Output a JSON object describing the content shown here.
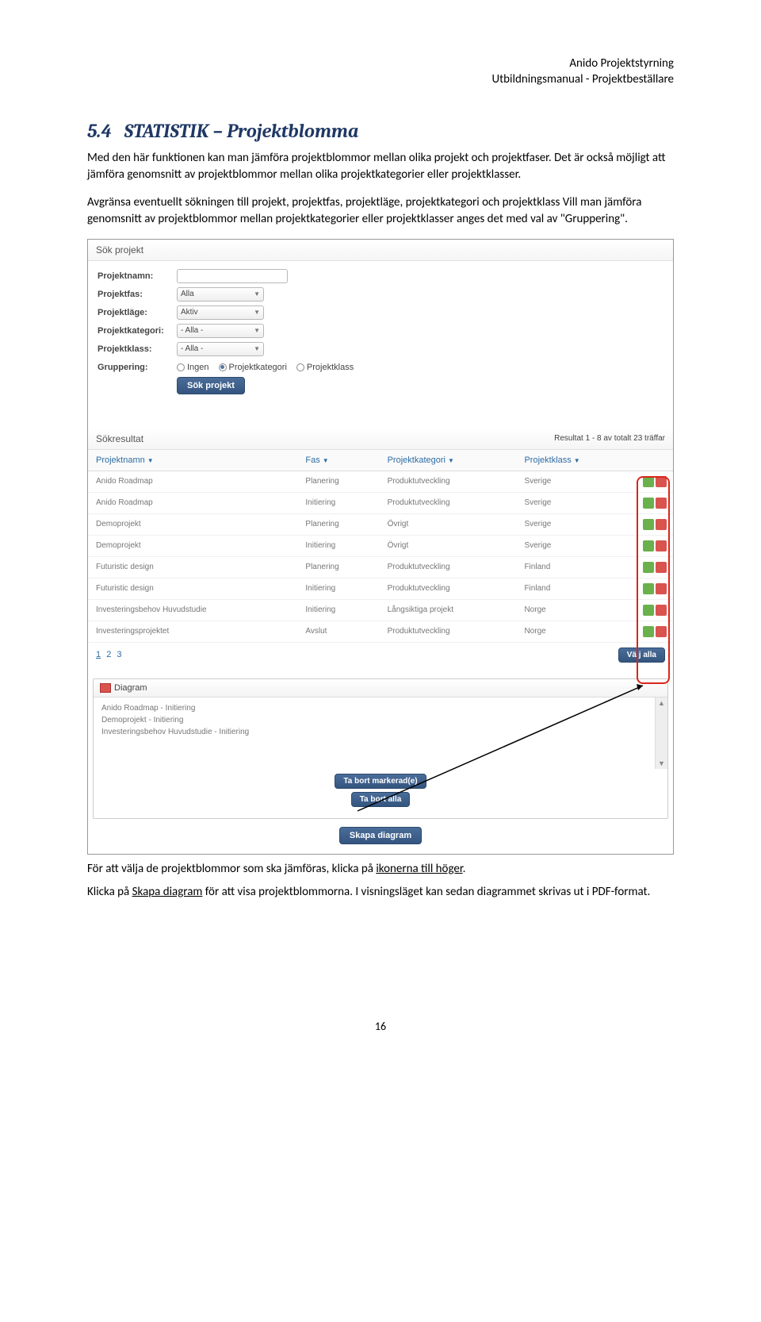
{
  "doc": {
    "header_l1": "Anido Projektstyrning",
    "header_l2": "Utbildningsmanual - Projektbeställare",
    "section_number": "5.4",
    "section_title": "STATISTIK – Projektblomma",
    "para1": "Med den här funktionen kan man jämföra projektblommor mellan olika projekt och projektfaser. Det är också möjligt att jämföra genomsnitt av projektblommor mellan olika projektkategorier eller projektklasser.",
    "para2": "Avgränsa eventuellt sökningen till projekt, projektfas, projektläge, projektkategori och projektklass Vill man jämföra genomsnitt av projektblommor mellan projektkategorier eller projektklasser anges det med val av \"Gruppering\".",
    "foot1_a": "För att välja de projektblommor som ska jämföras, klicka på ",
    "foot1_u": "ikonerna till höger",
    "foot1_b": ".",
    "foot2_a": "Klicka på ",
    "foot2_u": "Skapa diagram",
    "foot2_b": " för att visa projektblommorna. I visningsläget kan sedan diagrammet skrivas ut i PDF-format.",
    "page_num": "16"
  },
  "search": {
    "title": "Sök projekt",
    "labels": {
      "projektnamn": "Projektnamn:",
      "projektfas": "Projektfas:",
      "projektlage": "Projektläge:",
      "projektkategori": "Projektkategori:",
      "projektklass": "Projektklass:",
      "gruppering": "Gruppering:"
    },
    "values": {
      "projektfas": "Alla",
      "projektlage": "Aktiv",
      "projektkategori": "- Alla -",
      "projektklass": "- Alla -"
    },
    "radios": {
      "ingen": "Ingen",
      "projektkategori": "Projektkategori",
      "projektklass": "Projektklass"
    },
    "button": "Sök projekt"
  },
  "results": {
    "title": "Sökresultat",
    "count_text": "Resultat 1 - 8 av totalt 23 träffar",
    "columns": {
      "namn": "Projektnamn",
      "fas": "Fas",
      "kategori": "Projektkategori",
      "klass": "Projektklass"
    },
    "rows": [
      {
        "namn": "Anido Roadmap",
        "fas": "Planering",
        "kategori": "Produktutveckling",
        "klass": "Sverige"
      },
      {
        "namn": "Anido Roadmap",
        "fas": "Initiering",
        "kategori": "Produktutveckling",
        "klass": "Sverige"
      },
      {
        "namn": "Demoprojekt",
        "fas": "Planering",
        "kategori": "Övrigt",
        "klass": "Sverige"
      },
      {
        "namn": "Demoprojekt",
        "fas": "Initiering",
        "kategori": "Övrigt",
        "klass": "Sverige"
      },
      {
        "namn": "Futuristic design",
        "fas": "Planering",
        "kategori": "Produktutveckling",
        "klass": "Finland"
      },
      {
        "namn": "Futuristic design",
        "fas": "Initiering",
        "kategori": "Produktutveckling",
        "klass": "Finland"
      },
      {
        "namn": "Investeringsbehov Huvudstudie",
        "fas": "Initiering",
        "kategori": "Långsiktiga projekt",
        "klass": "Norge"
      },
      {
        "namn": "Investeringsprojektet",
        "fas": "Avslut",
        "kategori": "Produktutveckling",
        "klass": "Norge"
      }
    ],
    "pager": {
      "p1": "1",
      "p2": "2",
      "p3": "3"
    },
    "select_all": "Välj alla"
  },
  "diagram": {
    "title": "Diagram",
    "items": [
      "Anido Roadmap - Initiering",
      "Demoprojekt - Initiering",
      "Investeringsbehov Huvudstudie - Initiering"
    ],
    "btn_remove_sel": "Ta bort markerad(e)",
    "btn_remove_all": "Ta bort alla",
    "btn_create": "Skapa diagram"
  }
}
